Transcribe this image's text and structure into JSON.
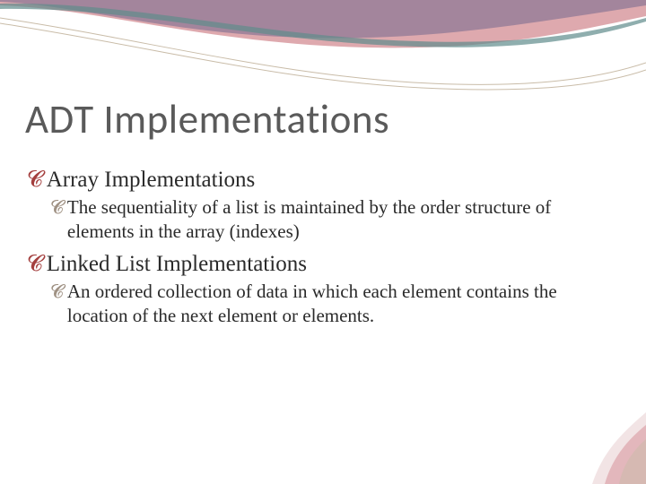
{
  "slide": {
    "title": "ADT Implementations",
    "bullets": [
      {
        "text": "Array Implementations",
        "children": [
          {
            "text": "The sequentiality of a list is maintained by the order structure of elements in the array (indexes)"
          }
        ]
      },
      {
        "text": "Linked List Implementations",
        "children": [
          {
            "text": "An ordered collection of data in which each element contains the location of the next element or elements."
          }
        ]
      }
    ]
  },
  "theme": {
    "accent_red": "#a43f3e",
    "accent_tan": "#9f9183",
    "wave_purple": "#7b6e8f",
    "wave_teal": "#5f8b8b",
    "wave_pink": "#d89aa0"
  }
}
